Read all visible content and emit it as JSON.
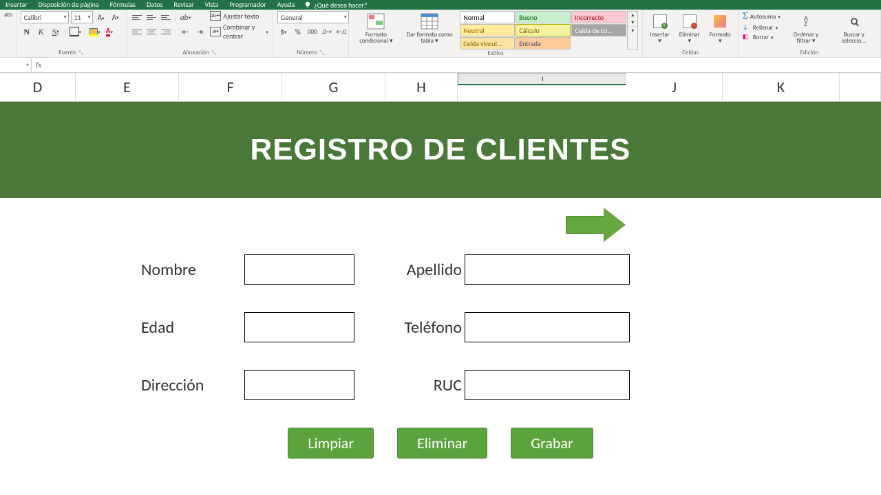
{
  "menu": {
    "tabs": [
      "Insertar",
      "Disposición de página",
      "Fórmulas",
      "Datos",
      "Revisar",
      "Vista",
      "Programador",
      "Ayuda"
    ],
    "tell_me": "¿Qué desea hacer?"
  },
  "ribbon": {
    "font": {
      "name": "Calibri",
      "size": "11",
      "group_label": "Fuente"
    },
    "alignment": {
      "wrap": "Ajustar texto",
      "merge": "Combinar y centrar",
      "group_label": "Alineación"
    },
    "number": {
      "format": "General",
      "group_label": "Número"
    },
    "styles": {
      "cond": "Formato condicional",
      "table": "Dar formato como tabla",
      "cells": [
        "Normal",
        "Bueno",
        "Incorrecto",
        "Neutral",
        "Cálculo",
        "Celda de co...",
        "Celda vincul...",
        "Entrada"
      ],
      "group_label": "Estilos"
    },
    "cells_group": {
      "insert": "Insertar",
      "delete": "Eliminar",
      "format": "Formato",
      "group_label": "Celdas"
    },
    "editing": {
      "autosum": "Autosuma",
      "fill": "Rellenar",
      "clear": "Borrar",
      "sort": "Ordenar y filtrar",
      "find": "Buscar y seleccio...",
      "group_label": "Edición"
    },
    "portapapeles": "ato"
  },
  "formula_bar": {
    "name_box": "",
    "fx": "fx",
    "content": ""
  },
  "columns": [
    "D",
    "E",
    "F",
    "G",
    "H",
    "I",
    "J",
    "K"
  ],
  "selected_column_index": 5,
  "form": {
    "title": "REGISTRO DE CLIENTES",
    "fields": {
      "nombre": "Nombre",
      "apellido": "Apellido",
      "edad": "Edad",
      "telefono": "Teléfono",
      "direccion": "Dirección",
      "ruc": "RUC"
    },
    "buttons": {
      "limpiar": "Limpiar",
      "eliminar": "Eliminar",
      "grabar": "Grabar"
    }
  }
}
